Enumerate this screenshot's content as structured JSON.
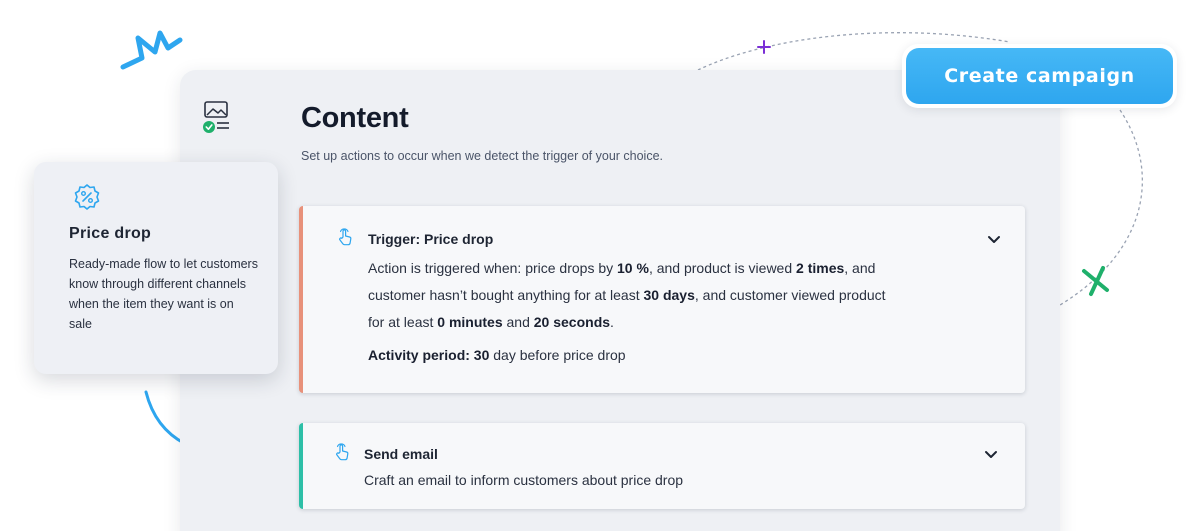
{
  "colors": {
    "accent_blue": "#2ea6ef",
    "trigger_border": "#e8917a",
    "email_border": "#2dbfa7",
    "check_green": "#1fb06b",
    "plus_purple": "#7b2fd6"
  },
  "header": {
    "icon": "image-checklist-icon",
    "title": "Content",
    "subtitle": "Set up actions to occur when we detect the trigger of your choice."
  },
  "cta": {
    "label": "Create campaign"
  },
  "flow_card": {
    "icon": "percent-badge-icon",
    "title": "Price drop",
    "description": "Ready-made flow to let customers know through different channels when the item they want is on sale"
  },
  "trigger_card": {
    "icon": "hand-pointer-icon",
    "title": "Trigger: Price drop",
    "desc": {
      "t1": "Action is triggered when: price drops by ",
      "b1": "10 %",
      "t2": ", and product is viewed ",
      "b2": "2 times",
      "t3": ", and customer hasn’t bought anything for at least ",
      "b3": "30 days",
      "t4": ", and customer viewed product for at least ",
      "b4": "0 minutes",
      "t5": " and ",
      "b5": "20 seconds",
      "t6": "."
    },
    "activity": {
      "label": "Activity period: ",
      "value": "30",
      "suffix": " day before price drop"
    }
  },
  "email_card": {
    "icon": "hand-pointer-icon",
    "title": "Send email",
    "description": "Craft an email to inform customers about price drop"
  }
}
